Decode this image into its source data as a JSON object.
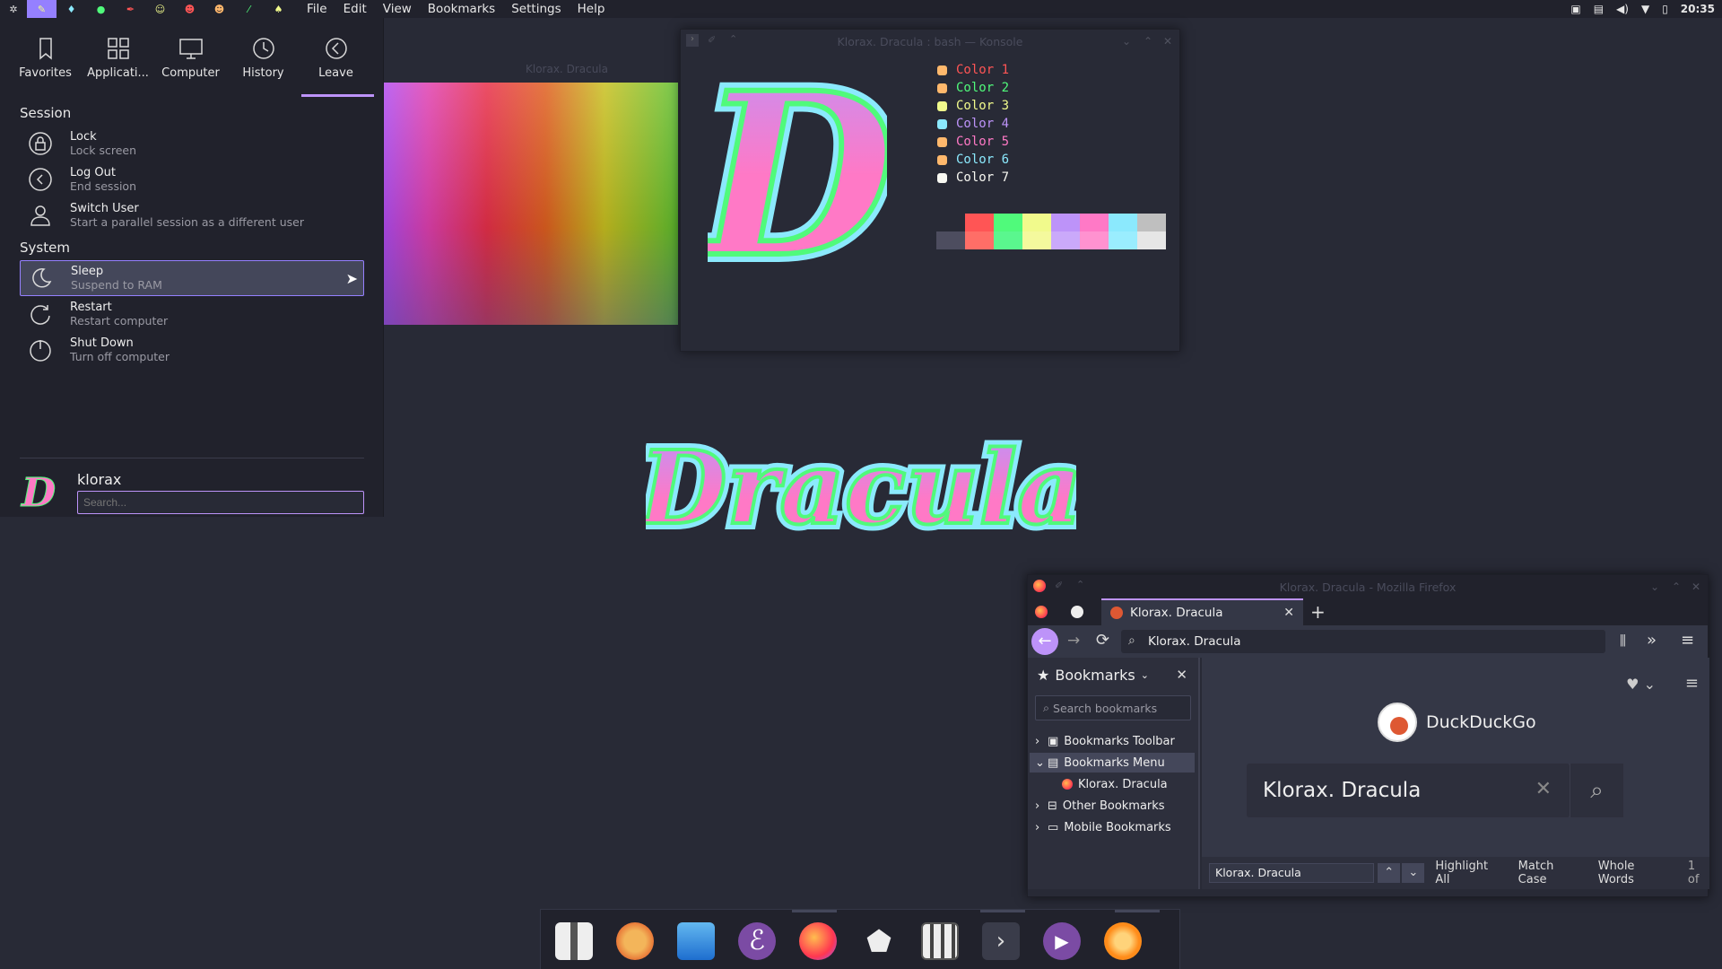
{
  "topbar": {
    "menu": [
      "File",
      "Edit",
      "View",
      "Bookmarks",
      "Settings",
      "Help"
    ],
    "clock": "20:35"
  },
  "launcher": {
    "tabs": [
      "Favorites",
      "Applicati...",
      "Computer",
      "History",
      "Leave"
    ],
    "active_tab": "Leave",
    "session_title": "Session",
    "session": [
      {
        "title": "Lock",
        "desc": "Lock screen",
        "icon": "lock-icon"
      },
      {
        "title": "Log Out",
        "desc": "End session",
        "icon": "logout-icon"
      },
      {
        "title": "Switch User",
        "desc": "Start a parallel session as a different user",
        "icon": "switch-user-icon"
      }
    ],
    "system_title": "System",
    "system": [
      {
        "title": "Sleep",
        "desc": "Suspend to RAM",
        "icon": "sleep-icon"
      },
      {
        "title": "Restart",
        "desc": "Restart computer",
        "icon": "restart-icon"
      },
      {
        "title": "Shut Down",
        "desc": "Turn off computer",
        "icon": "power-icon"
      }
    ],
    "user": "klorax",
    "search_placeholder": "Search..."
  },
  "wallpaper_window": {
    "title": "Klorax. Dracula"
  },
  "konsole": {
    "title": "Klorax. Dracula : bash — Konsole",
    "colors": [
      {
        "label": "Color 1",
        "color": "#ff5555"
      },
      {
        "label": "Color 2",
        "color": "#50fa7b"
      },
      {
        "label": "Color 3",
        "color": "#f1fa8c"
      },
      {
        "label": "Color 4",
        "color": "#bd93f9"
      },
      {
        "label": "Color 5",
        "color": "#ff79c6"
      },
      {
        "label": "Color 6",
        "color": "#8be9fd"
      },
      {
        "label": "Color 7",
        "color": "#f8f8f2"
      }
    ],
    "palette_top": [
      "#282a36",
      "#ff5555",
      "#50fa7b",
      "#f1fa8c",
      "#bd93f9",
      "#ff79c6",
      "#8be9fd",
      "#bfbfbf"
    ],
    "palette_bottom": [
      "#4d4d5f",
      "#ff6e67",
      "#5af78e",
      "#f4f99d",
      "#caa9fa",
      "#ff92d0",
      "#9aedfe",
      "#e6e6e6"
    ]
  },
  "logo_text": "Dracula",
  "firefox": {
    "title": "Klorax. Dracula - Mozilla Firefox",
    "tab_label": "Klorax. Dracula",
    "url": "Klorax. Dracula",
    "sidebar_title": "Bookmarks",
    "search_bookmarks_placeholder": "Search bookmarks",
    "bookmarks": [
      {
        "label": "Bookmarks Toolbar",
        "expander": "›"
      },
      {
        "label": "Bookmarks Menu",
        "expander": "⌄"
      },
      {
        "label": "Klorax. Dracula",
        "expander": ""
      },
      {
        "label": "Other Bookmarks",
        "expander": "›"
      },
      {
        "label": "Mobile Bookmarks",
        "expander": "›"
      }
    ],
    "ddg_name": "DuckDuckGo",
    "ddg_query": "Klorax. Dracula",
    "find_value": "Klorax. Dracula",
    "find_options": [
      "Highlight All",
      "Match Case",
      "Whole Words"
    ],
    "find_count": "1 of"
  },
  "dock": {
    "apps": [
      "archive-manager",
      "gimp",
      "file-manager",
      "emacs",
      "firefox",
      "inkscape",
      "calculator",
      "terminal",
      "media-player",
      "orange-app"
    ]
  }
}
